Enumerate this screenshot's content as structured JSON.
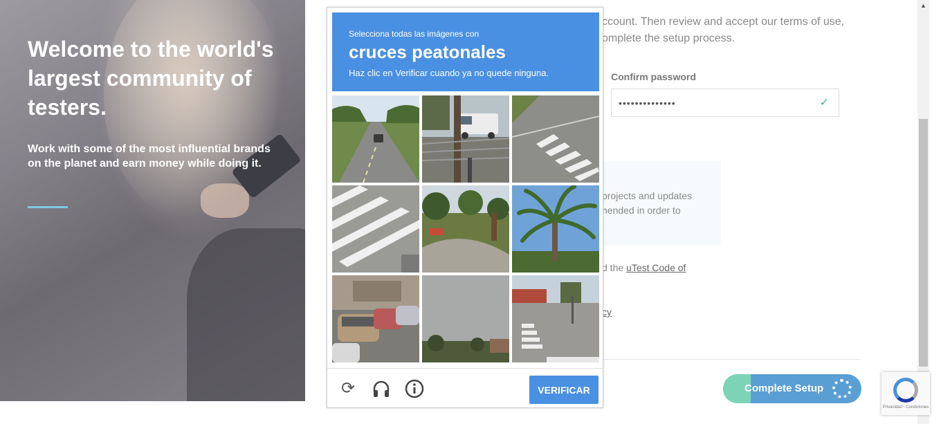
{
  "hero": {
    "title": "Welcome to the world's largest community of testers.",
    "subtitle": "Work with some of the most influential brands on the planet and earn money while doing it."
  },
  "form": {
    "intro_line1": "ccount. Then review and accept our terms of use,",
    "intro_line2": "omplete the setup process.",
    "confirm_password_label": "Confirm password",
    "confirm_password_value": "••••••••••••••",
    "info_line1": "projects and updates",
    "info_line2": "nended in order to",
    "code_prefix": "d the ",
    "code_link": "uTest Code of",
    "policy_fragment": "cy",
    "complete_setup_label": "Complete Setup"
  },
  "captcha": {
    "select_all_text": "Selecciona todas las imágenes con",
    "target_object": "cruces peatonales",
    "instruction": "Haz clic en Verificar cuando ya no quede ninguna.",
    "verify_label": "VERIFICAR",
    "tiles": [
      "road-with-car",
      "pole-and-fence-with-truck",
      "crosswalk-corner",
      "crosswalk-stripes",
      "sidewalk-with-trees",
      "palm-tree",
      "parked-cars",
      "trees-and-cloudy-sky",
      "street-with-crosswalk"
    ]
  },
  "recaptcha_badge": {
    "footer": "Privacidad - Condiciones"
  },
  "colors": {
    "captcha_blue": "#4a90e2",
    "accent_teal": "#7dd3b6",
    "hero_underline": "#7ec8e3"
  }
}
